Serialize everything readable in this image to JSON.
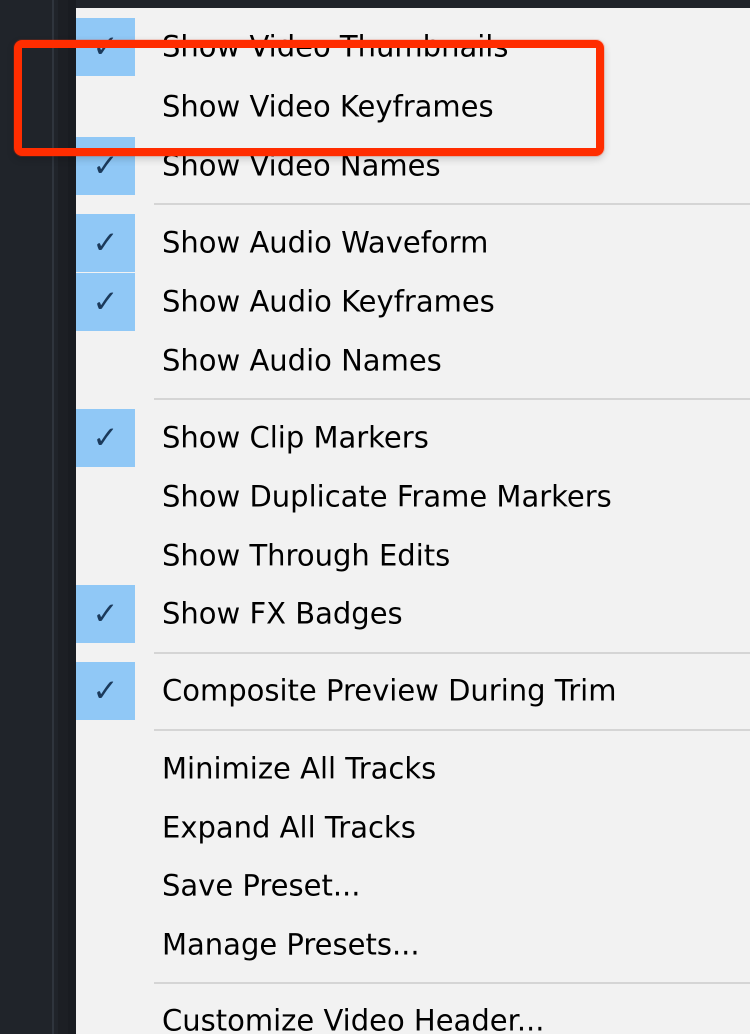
{
  "menu": {
    "items": [
      {
        "label": "Show Video Thumbnails",
        "checked": true
      },
      {
        "label": "Show Video Keyframes",
        "checked": false
      },
      {
        "label": "Show Video Names",
        "checked": true
      },
      {
        "label": "Show Audio Waveform",
        "checked": true
      },
      {
        "label": "Show Audio Keyframes",
        "checked": true
      },
      {
        "label": "Show Audio Names",
        "checked": false
      },
      {
        "label": "Show Clip Markers",
        "checked": true
      },
      {
        "label": "Show Duplicate Frame Markers",
        "checked": false
      },
      {
        "label": "Show Through Edits",
        "checked": false
      },
      {
        "label": "Show FX Badges",
        "checked": true
      },
      {
        "label": "Composite Preview During Trim",
        "checked": true
      },
      {
        "label": "Minimize All Tracks",
        "checked": false
      },
      {
        "label": "Expand All Tracks",
        "checked": false
      },
      {
        "label": "Save Preset...",
        "checked": false
      },
      {
        "label": "Manage Presets...",
        "checked": false
      },
      {
        "label": "Customize Video Header...",
        "checked": false
      }
    ]
  },
  "icons": {
    "check": "check-icon"
  },
  "colors": {
    "menu_background": "#f2f2f2",
    "check_background": "#90c8f6",
    "highlight": "#ff2d00",
    "separator": "#d5d5d5"
  }
}
